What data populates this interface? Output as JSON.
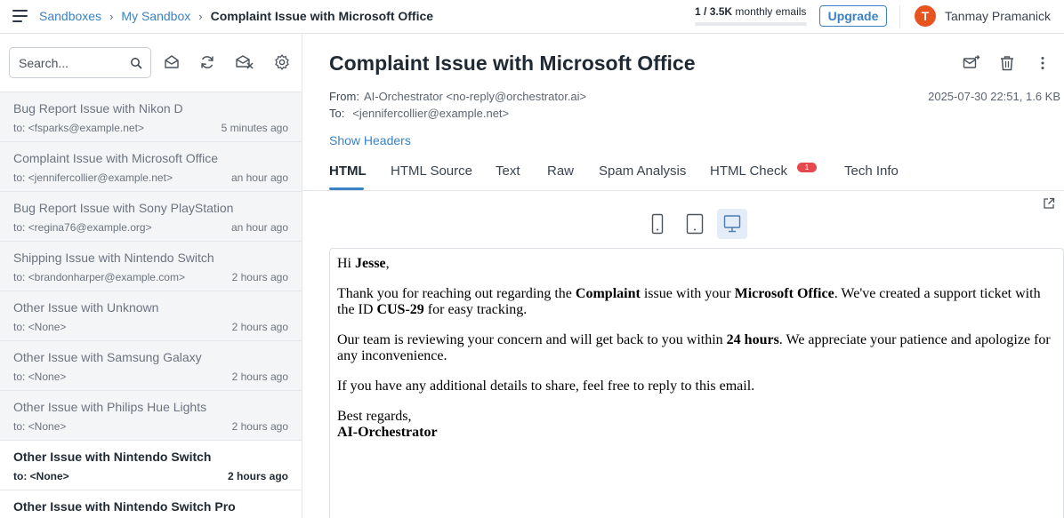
{
  "breadcrumb": {
    "items": [
      "Sandboxes",
      "My Sandbox"
    ],
    "current": "Complaint Issue with Microsoft Office",
    "separator": "›"
  },
  "quota": {
    "used": "1",
    "total": "3.5K",
    "label": "monthly emails",
    "fraction": 0.0003
  },
  "header": {
    "upgrade_label": "Upgrade",
    "avatar_initial": "T",
    "avatar_color": "#e8541e",
    "user_name": "Tanmay Pramanick"
  },
  "sidebar": {
    "search_placeholder": "Search...",
    "toolbar_icons": [
      "mark-read-icon",
      "refresh-icon",
      "delete-all-icon",
      "settings-icon"
    ],
    "messages": [
      {
        "subject": "Bug Report Issue with Nikon D",
        "to": "to: <fsparks@example.net>",
        "time": "5 minutes ago",
        "unread": false
      },
      {
        "subject": "Complaint Issue with Microsoft Office",
        "to": "to: <jennifercollier@example.net>",
        "time": "an hour ago",
        "unread": false
      },
      {
        "subject": "Bug Report Issue with Sony PlayStation",
        "to": "to: <regina76@example.org>",
        "time": "an hour ago",
        "unread": false
      },
      {
        "subject": "Shipping Issue with Nintendo Switch",
        "to": "to: <brandonharper@example.com>",
        "time": "2 hours ago",
        "unread": false
      },
      {
        "subject": "Other Issue with Unknown",
        "to": "to: <None>",
        "time": "2 hours ago",
        "unread": false
      },
      {
        "subject": "Other Issue with Samsung Galaxy",
        "to": "to: <None>",
        "time": "2 hours ago",
        "unread": false
      },
      {
        "subject": "Other Issue with Philips Hue Lights",
        "to": "to: <None>",
        "time": "2 hours ago",
        "unread": false
      },
      {
        "subject": "Other Issue with Nintendo Switch",
        "to": "to: <None>",
        "time": "2 hours ago",
        "unread": true
      },
      {
        "subject": "Other Issue with Nintendo Switch Pro",
        "to": "",
        "time": "",
        "unread": true
      }
    ]
  },
  "email": {
    "title": "Complaint Issue with Microsoft Office",
    "from_label": "From:",
    "from_value": "AI-Orchestrator <no-reply@orchestrator.ai>",
    "to_label": "To:",
    "to_value": "<jennifercollier@example.net>",
    "date_size": "2025-07-30 22:51, 1.6 KB",
    "show_headers": "Show Headers",
    "tabs": [
      "HTML",
      "HTML Source",
      "Text",
      "Raw",
      "Spam Analysis",
      "HTML Check",
      "Tech Info"
    ],
    "active_tab": "HTML",
    "html_check_badge": "1",
    "device_views": [
      "mobile-view-icon",
      "tablet-view-icon",
      "desktop-view-icon"
    ],
    "active_device": "desktop-view-icon",
    "body": {
      "greeting_prefix": "Hi ",
      "greeting_name": "Jesse",
      "greeting_suffix": ",",
      "p1_a": "Thank you for reaching out regarding the ",
      "p1_b": "Complaint",
      "p1_c": " issue with your ",
      "p1_d": "Microsoft Office",
      "p1_e": ". We've created a support ticket with the ID ",
      "p1_f": "CUS-29",
      "p1_g": " for easy tracking.",
      "p2_a": "Our team is reviewing your concern and will get back to you within ",
      "p2_b": "24 hours",
      "p2_c": ". We appreciate your patience and apologize for any inconvenience.",
      "p3": "If you have any additional details to share, feel free to reply to this email.",
      "closing": "Best regards,",
      "signature": "AI-Orchestrator"
    }
  }
}
